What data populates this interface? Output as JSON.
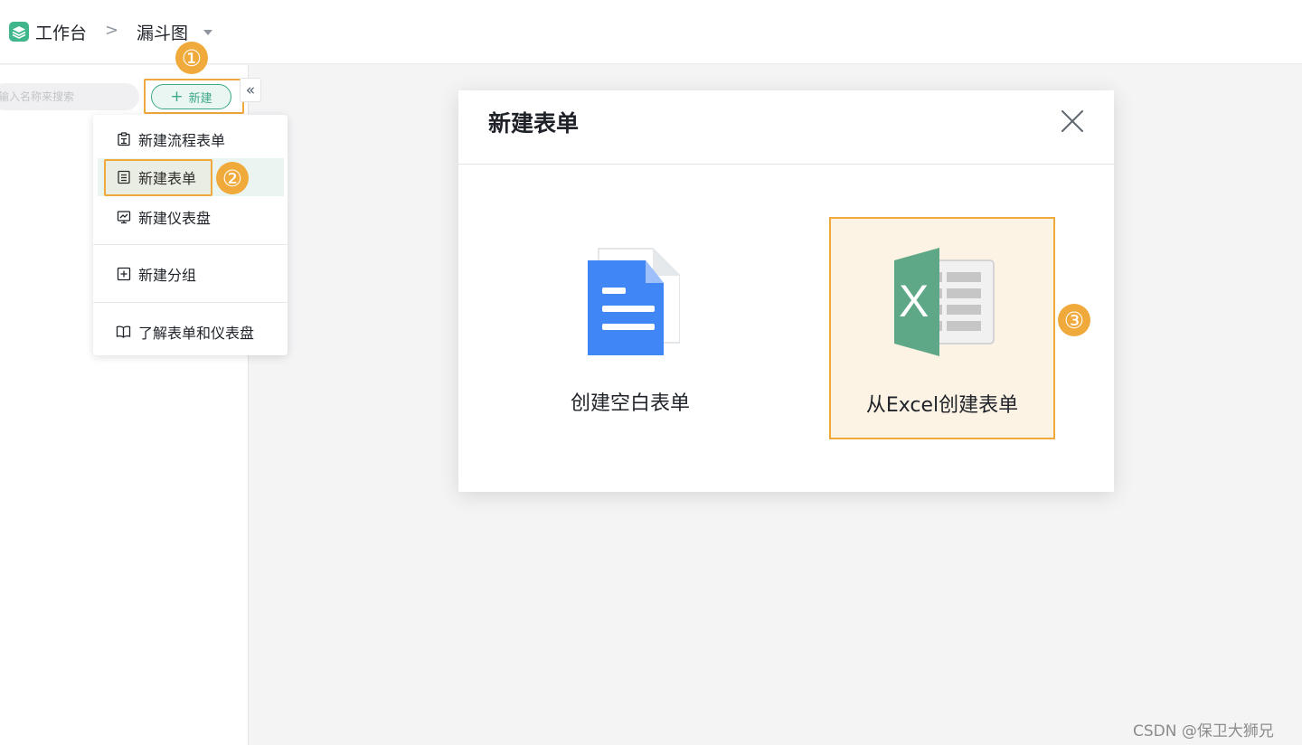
{
  "topbar": {
    "home_label": "工作台",
    "separator": ">",
    "current_label": "漏斗图"
  },
  "sidebar": {
    "search_placeholder": "输入名称来搜索",
    "new_button_label": "新建",
    "collapse_glyph": "«"
  },
  "steps": [
    "①",
    "②",
    "③"
  ],
  "dropdown": {
    "items": [
      {
        "label": "新建流程表单",
        "icon": "flow-form-icon"
      },
      {
        "label": "新建表单",
        "icon": "form-icon"
      },
      {
        "label": "新建仪表盘",
        "icon": "dashboard-icon"
      },
      {
        "label": "新建分组",
        "icon": "add-group-icon"
      },
      {
        "label": "了解表单和仪表盘",
        "icon": "book-icon"
      }
    ]
  },
  "modal": {
    "title": "新建表单",
    "options": [
      {
        "label": "创建空白表单",
        "icon": "document-icon"
      },
      {
        "label": "从Excel创建表单",
        "icon": "excel-icon",
        "excel_letter": "X"
      }
    ]
  },
  "colors": {
    "accent_green": "#3fa88a",
    "highlight_orange": "#f0a93b",
    "doc_blue": "#4086f4",
    "excel_green": "#5ea887"
  },
  "watermark": "CSDN @保卫大狮兄"
}
